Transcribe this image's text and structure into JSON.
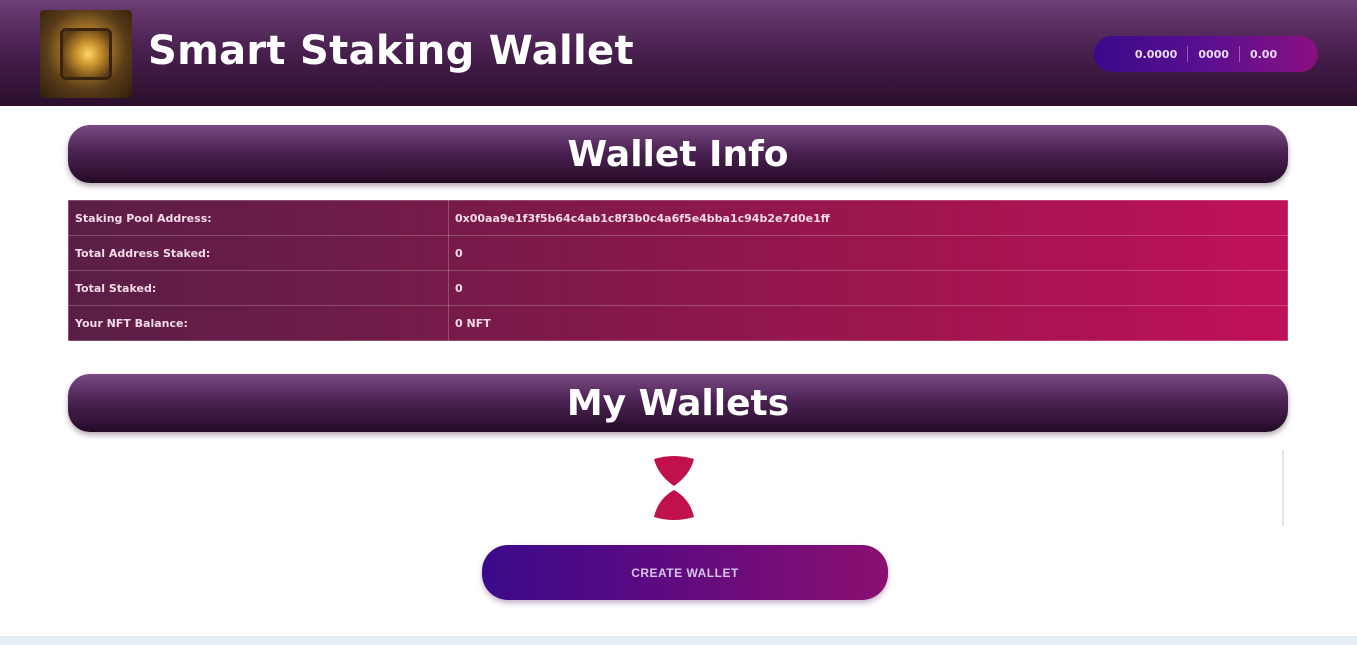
{
  "header": {
    "title": "Smart Staking Wallet",
    "network_badge": [
      "0.0000",
      "0000",
      "0.00"
    ]
  },
  "wallet_info": {
    "title": "Wallet Info",
    "rows": [
      {
        "label": "Staking Pool Address:",
        "value": "0x00aa9e1f3f5b64c4ab1c8f3b0c4a6f5e4bba1c94b2e7d0e1ff"
      },
      {
        "label": "Total Address Staked:",
        "value": "0"
      },
      {
        "label": "Total Staked:",
        "value": "0"
      },
      {
        "label": "Your NFT Balance:",
        "value": "0 NFT"
      }
    ]
  },
  "my_wallets": {
    "title": "My Wallets",
    "create_button": "CREATE WALLET"
  },
  "colors": {
    "header_dark": "#2a0e2c",
    "accent_pink": "#c0105a",
    "accent_purple": "#3a0a8a"
  },
  "icons": {
    "logo": "wallet-logo-icon",
    "loader": "hourglass-loading-icon"
  }
}
